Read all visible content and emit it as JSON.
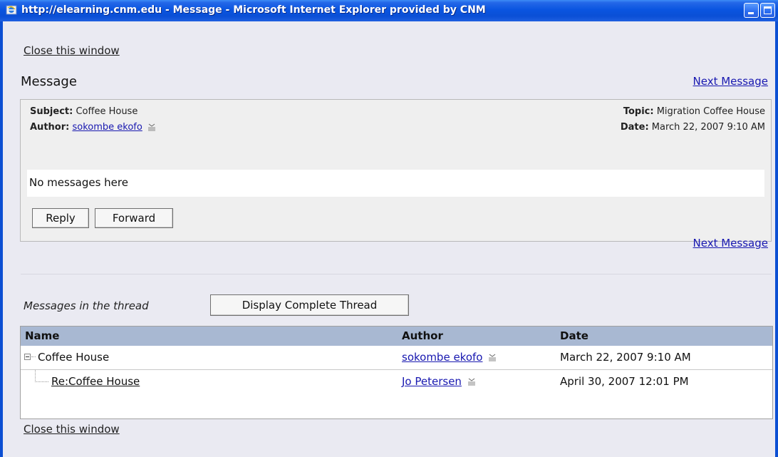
{
  "window": {
    "title": "http://elearning.cnm.edu - Message - Microsoft Internet Explorer provided by CNM"
  },
  "nav": {
    "close_top": "Close this window",
    "close_bottom": "Close this window",
    "next_top": "Next Message",
    "next_bottom": "Next Message"
  },
  "message": {
    "heading": "Message",
    "subject_label": "Subject:",
    "subject": "Coffee House",
    "author_label": "Author:",
    "author": "sokombe ekofo",
    "topic_label": "Topic:",
    "topic": "Migration Coffee House",
    "date_label": "Date:",
    "date": "March 22, 2007 9:10 AM",
    "body": "No messages here",
    "reply_label": "Reply",
    "forward_label": "Forward"
  },
  "thread": {
    "label": "Messages in the thread",
    "display_complete_label": "Display Complete Thread",
    "columns": [
      "Name",
      "Author",
      "Date"
    ],
    "rows": [
      {
        "name": "Coffee House",
        "author": "sokombe ekofo",
        "date": "March 22, 2007 9:10 AM"
      },
      {
        "name": "Re:Coffee House",
        "author": "Jo Petersen",
        "date": "April 30, 2007 12:01 PM"
      }
    ]
  }
}
